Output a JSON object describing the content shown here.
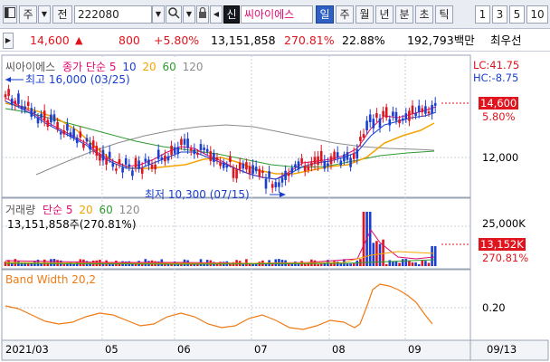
{
  "toolbar": {
    "btn_ju": "주",
    "btn_jeon": "전",
    "stock_code": "222080",
    "btn_sin": "신",
    "stock_name": "씨아이에스",
    "periods": [
      "일",
      "주",
      "월",
      "년",
      "분",
      "초",
      "틱"
    ],
    "minutes": [
      "1",
      "3",
      "5",
      "10"
    ]
  },
  "quote": {
    "price": "14,600",
    "change": "800",
    "change_pct": "+5.80%",
    "volume": "13,151,858",
    "volume_ratio": "270.81%",
    "turnover": "22.88%",
    "trade_value": "192,793백만",
    "best_quote_label": "최우선"
  },
  "price_panel": {
    "legend_name": "씨아이에스",
    "legend_ma": "종가 단순",
    "ma_periods": [
      "5",
      "10",
      "20",
      "60",
      "120"
    ],
    "high_note": "최고 16,000 (03/25)",
    "low_note": "최저 10,300 (07/15)",
    "lc": "LC:41.75",
    "hc": "HC:-8.75",
    "price_tag": "14,600",
    "pct_tag": "5.80%",
    "axis_12000": "12,000"
  },
  "volume_panel": {
    "legend_name": "거래량",
    "legend_ma": "단순",
    "ma_periods": [
      "5",
      "20",
      "60",
      "120"
    ],
    "summary": "13,151,858주(270.81%)",
    "axis_25000k": "25,000K",
    "volume_tag": "13,152K",
    "pct_tag": "270.81%"
  },
  "bw_panel": {
    "legend": "Band Width 20,2",
    "axis_020": "0.20"
  },
  "x_axis": {
    "labels": [
      "2021/03",
      "05",
      "06",
      "07",
      "08",
      "09",
      "09/13"
    ]
  },
  "colors": {
    "up": "#e0141e",
    "down": "#1a3fd0",
    "ma5": "#e10a6e",
    "ma10": "#1a3fd0",
    "ma20": "#f5a300",
    "ma60": "#2e9b2e",
    "ma120": "#8c8c8c",
    "bandwidth": "#f07a14"
  }
}
